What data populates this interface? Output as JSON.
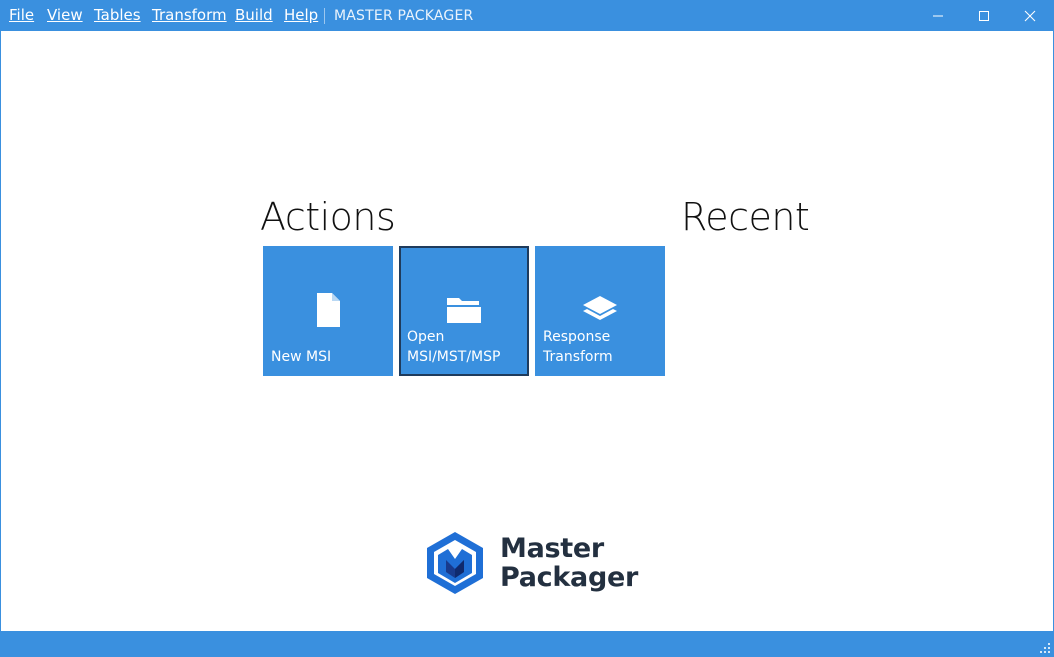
{
  "menu": {
    "items": [
      {
        "label": "File",
        "mnemonic": "F"
      },
      {
        "label": "View",
        "mnemonic": "V"
      },
      {
        "label": "Tables",
        "mnemonic": "T"
      },
      {
        "label": "Transform",
        "mnemonic": "T"
      },
      {
        "label": "Build",
        "mnemonic": "B"
      },
      {
        "label": "Help",
        "mnemonic": "H"
      }
    ]
  },
  "app_title": "MASTER PACKAGER",
  "window_controls": {
    "icons": [
      "minimize-icon",
      "maximize-icon",
      "close-icon"
    ]
  },
  "actions": {
    "heading": "Actions",
    "tiles": [
      {
        "line1": "New MSI",
        "line2": "",
        "icon": "document-icon",
        "selected": false
      },
      {
        "line1": "Open",
        "line2": "MSI/MST/MSP",
        "icon": "folder-icon",
        "selected": true
      },
      {
        "line1": "Response",
        "line2": "Transform",
        "icon": "layers-icon",
        "selected": false
      }
    ]
  },
  "recent": {
    "heading": "Recent",
    "items": []
  },
  "logo": {
    "line1": "Master",
    "line2": "Packager"
  },
  "colors": {
    "accent": "#3a90df",
    "selected_border": "#1f3b5c",
    "logo_text": "#233040"
  }
}
